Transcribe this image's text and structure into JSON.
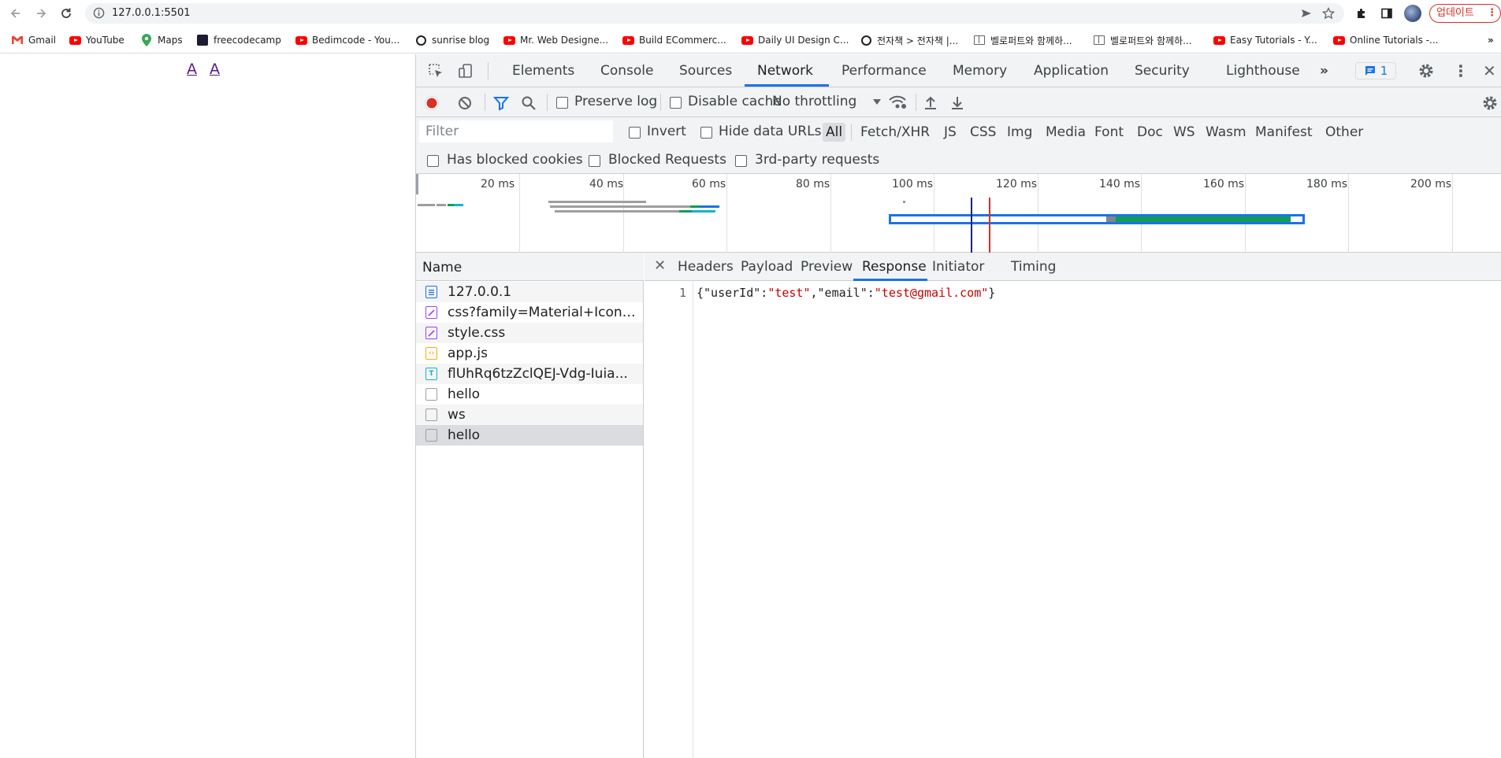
{
  "browser": {
    "url": "127.0.0.1:5501",
    "update_button": "업데이트",
    "bookmarks": [
      {
        "label": "Gmail",
        "icon": "gmail-icon"
      },
      {
        "label": "YouTube",
        "icon": "youtube-icon"
      },
      {
        "label": "Maps",
        "icon": "maps-icon"
      },
      {
        "label": "freecodecamp",
        "icon": "freecodecamp-icon"
      },
      {
        "label": "Bedimcode - You...",
        "icon": "youtube-icon"
      },
      {
        "label": "sunrise blog",
        "icon": "globe-icon"
      },
      {
        "label": "Mr. Web Designe...",
        "icon": "youtube-icon"
      },
      {
        "label": "Build ECommerc...",
        "icon": "youtube-icon"
      },
      {
        "label": "Daily UI Design C...",
        "icon": "youtube-icon"
      },
      {
        "label": "전자책 > 전자책 |...",
        "icon": "globe-icon"
      },
      {
        "label": "벨로퍼트와 함께하...",
        "icon": "book-icon"
      },
      {
        "label": "벨로퍼트와 함께하...",
        "icon": "book-icon"
      },
      {
        "label": "Easy Tutorials - Y...",
        "icon": "youtube-icon"
      },
      {
        "label": "Online Tutorials -...",
        "icon": "youtube-icon"
      }
    ]
  },
  "page": {
    "links": [
      "A",
      "A"
    ]
  },
  "devtools": {
    "tabs": [
      "Elements",
      "Console",
      "Sources",
      "Network",
      "Performance",
      "Memory",
      "Application",
      "Security",
      "Lighthouse"
    ],
    "active_tab": "Network",
    "issues_count": "1",
    "actions": {
      "preserve_log": "Preserve log",
      "disable_cache": "Disable cache",
      "throttling": "No throttling"
    },
    "filter": {
      "placeholder": "Filter",
      "invert": "Invert",
      "hide_data_urls": "Hide data URLs",
      "types": [
        "All",
        "Fetch/XHR",
        "JS",
        "CSS",
        "Img",
        "Media",
        "Font",
        "Doc",
        "WS",
        "Wasm",
        "Manifest",
        "Other"
      ],
      "active_type": "All",
      "has_blocked_cookies": "Has blocked cookies",
      "blocked_requests": "Blocked Requests",
      "third_party": "3rd-party requests"
    },
    "overview": {
      "ticks": [
        "20 ms",
        "40 ms",
        "60 ms",
        "80 ms",
        "100 ms",
        "120 ms",
        "140 ms",
        "160 ms",
        "180 ms",
        "200 ms"
      ]
    },
    "requests": {
      "header": "Name",
      "rows": [
        {
          "name": "127.0.0.1",
          "type": "doc",
          "color": "#1a73e8"
        },
        {
          "name": "css?family=Material+Icons|...",
          "type": "css",
          "color": "#a142f4"
        },
        {
          "name": "style.css",
          "type": "css",
          "color": "#a142f4"
        },
        {
          "name": "app.js",
          "type": "js",
          "color": "#f9ab00"
        },
        {
          "name": "flUhRq6tzZclQEJ-Vdg-Iuia...",
          "type": "font",
          "color": "#12b5cb"
        },
        {
          "name": "hello",
          "type": "other",
          "color": "#9aa0a6"
        },
        {
          "name": "ws",
          "type": "other",
          "color": "#9aa0a6"
        },
        {
          "name": "hello",
          "type": "other",
          "color": "#9aa0a6"
        }
      ],
      "selected_index": 7
    },
    "details": {
      "tabs": [
        "Headers",
        "Payload",
        "Preview",
        "Response",
        "Initiator",
        "Timing"
      ],
      "active_tab": "Response",
      "line_number": "1",
      "response": {
        "open": "{",
        "k1": "\"userId\"",
        "v1": "\"test\"",
        "k2": "\"email\"",
        "v2": "\"test@gmail.com\"",
        "close": "}"
      }
    }
  },
  "colors": {
    "accent": "#1a73e8",
    "record": "#d93025",
    "json_string": "#c80000"
  }
}
